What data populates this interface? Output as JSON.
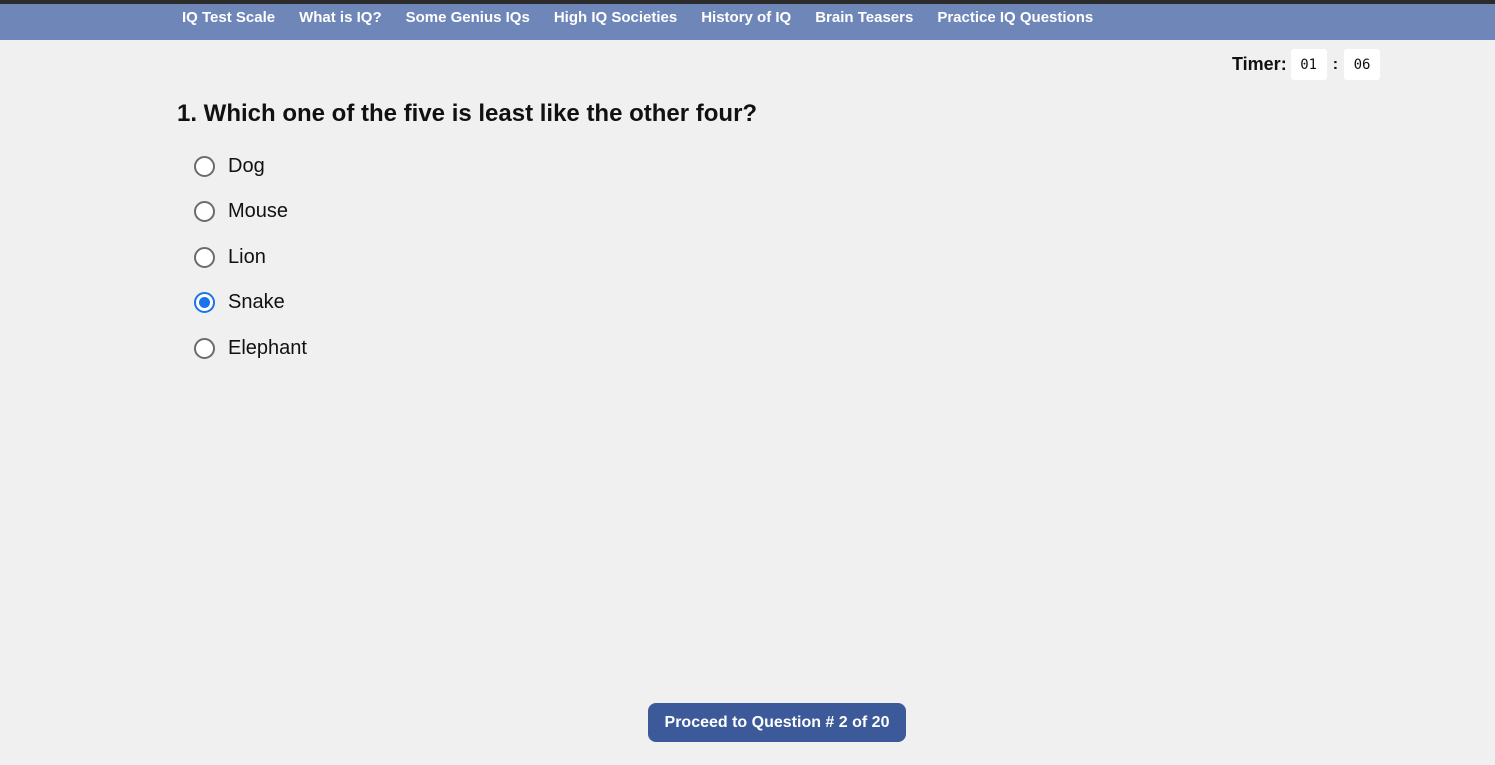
{
  "nav": {
    "links": [
      "IQ Test Scale",
      "What is IQ?",
      "Some Genius IQs",
      "High IQ Societies",
      "History of IQ",
      "Brain Teasers",
      "Practice IQ Questions"
    ]
  },
  "timer": {
    "label": "Timer:",
    "minutes": "01",
    "separator": ":",
    "seconds": "06"
  },
  "question": {
    "text": "1. Which one of the five is least like the other four?",
    "options": [
      "Dog",
      "Mouse",
      "Lion",
      "Snake",
      "Elephant"
    ],
    "selected": "Snake"
  },
  "proceed_button": {
    "label": "Proceed to Question # 2 of 20"
  },
  "colors": {
    "navbar": "#6f86b8",
    "button": "#3c5a9a",
    "radio_selected": "#1a73e8",
    "background": "#f0f0f0"
  }
}
